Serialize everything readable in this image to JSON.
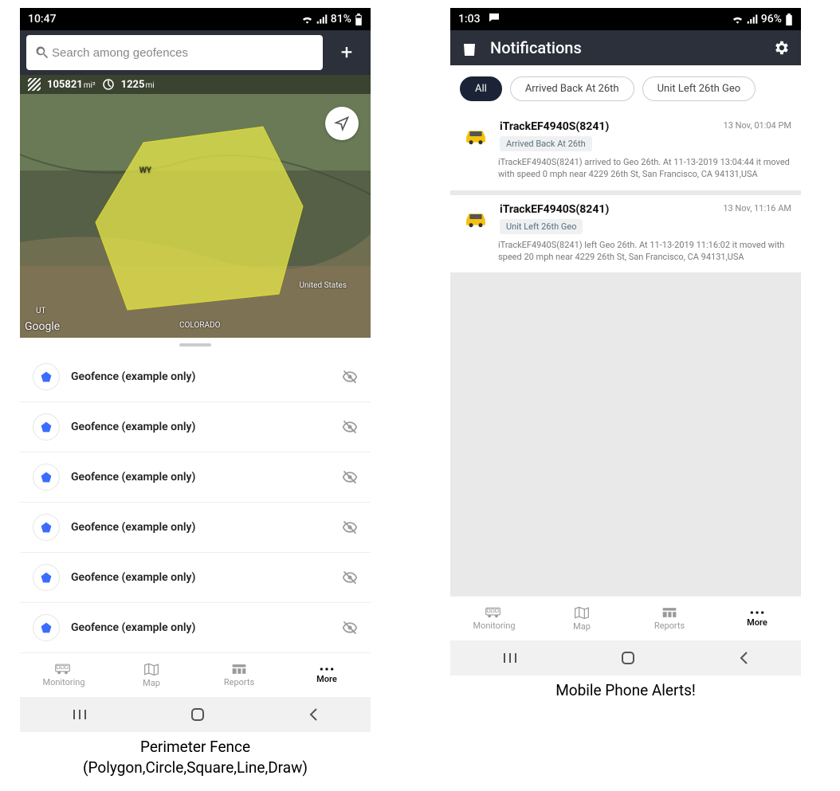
{
  "left": {
    "statusbar": {
      "time": "10:47",
      "battery": "81%"
    },
    "search": {
      "placeholder": "Search among geofences"
    },
    "map": {
      "area_value": "105821",
      "area_unit": "mi²",
      "perim_value": "1225",
      "perim_unit": "mi",
      "labels": {
        "wy": "WY",
        "ut": "UT",
        "us": "United States",
        "co": "COLORADO"
      },
      "google": "Google"
    },
    "geofences": [
      {
        "label": "Geofence (example only)"
      },
      {
        "label": "Geofence (example only)"
      },
      {
        "label": "Geofence (example only)"
      },
      {
        "label": "Geofence (example only)"
      },
      {
        "label": "Geofence (example only)"
      },
      {
        "label": "Geofence (example only)"
      }
    ],
    "bottom": {
      "monitoring": "Monitoring",
      "map": "Map",
      "reports": "Reports",
      "more": "More"
    },
    "caption_l1": "Perimeter Fence",
    "caption_l2": "(Polygon,Circle,Square,Line,Draw)"
  },
  "right": {
    "statusbar": {
      "time": "1:03",
      "battery": "96%"
    },
    "header": {
      "title": "Notifications"
    },
    "chips": {
      "all": "All",
      "c1": "Arrived Back At 26th",
      "c2": "Unit Left 26th Geo"
    },
    "notifs": [
      {
        "title": "iTrackEF4940S(8241)",
        "tag": "Arrived Back At 26th",
        "ts": "13 Nov, 01:04 PM",
        "desc": "iTrackEF4940S(8241) arrived to Geo 26th.    At 11-13-2019 13:04:44 it moved with speed 0 mph near 4229 26th St, San Francisco, CA 94131,USA"
      },
      {
        "title": "iTrackEF4940S(8241)",
        "tag": "Unit Left 26th Geo",
        "ts": "13 Nov, 11:16 AM",
        "desc": "iTrackEF4940S(8241) left Geo 26th.    At 11-13-2019 11:16:02 it moved with speed 20 mph near 4229 26th St, San Francisco, CA 94131,USA"
      }
    ],
    "bottom": {
      "monitoring": "Monitoring",
      "map": "Map",
      "reports": "Reports",
      "more": "More"
    },
    "caption": "Mobile Phone Alerts!"
  }
}
